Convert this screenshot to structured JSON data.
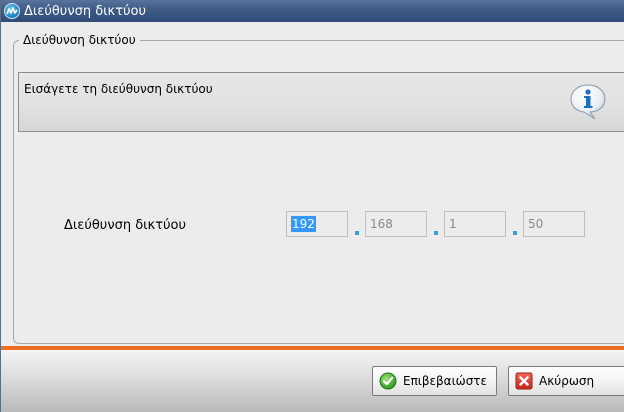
{
  "window": {
    "title": "Διεύθυνση δικτύου",
    "icon": "app-logo-icon"
  },
  "group": {
    "legend": "Διεύθυνση δικτύου"
  },
  "info": {
    "text": "Εισάγετε τη διεύθυνση δικτύου",
    "icon": "info-icon"
  },
  "address": {
    "label": "Διεύθυνση δικτύου",
    "octets": [
      "192",
      "168",
      "1",
      "50"
    ],
    "selected_octet": 0
  },
  "buttons": {
    "confirm_label": "Επιβεβαιώστε",
    "confirm_icon": "check-icon",
    "cancel_label": "Ακύρωση",
    "cancel_icon": "close-icon"
  },
  "colors": {
    "accent_line": "#ec6d24",
    "titlebar": "#3e5a85",
    "selection": "#3399ff"
  }
}
